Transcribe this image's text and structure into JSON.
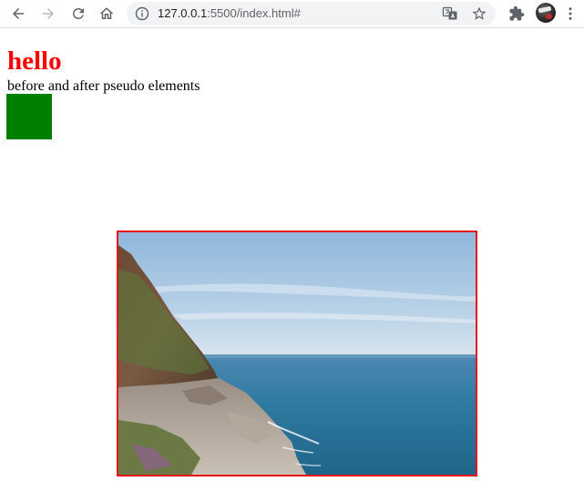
{
  "browser": {
    "url": {
      "host": "127.0.0.1",
      "path": ":5500/index.html#"
    },
    "icons": {
      "back": "back-arrow-icon",
      "forward": "forward-arrow-icon",
      "reload": "reload-icon",
      "home": "home-icon",
      "site_info": "info-icon",
      "translate": "translate-icon",
      "bookmark": "star-icon",
      "extensions": "puzzle-icon",
      "profile": "avatar"
    }
  },
  "content": {
    "heading": "hello",
    "subtext": "before and after pseudo elements",
    "colors": {
      "heading": "#ff0000",
      "box": "#008000",
      "image_border": "#e8161b"
    }
  }
}
